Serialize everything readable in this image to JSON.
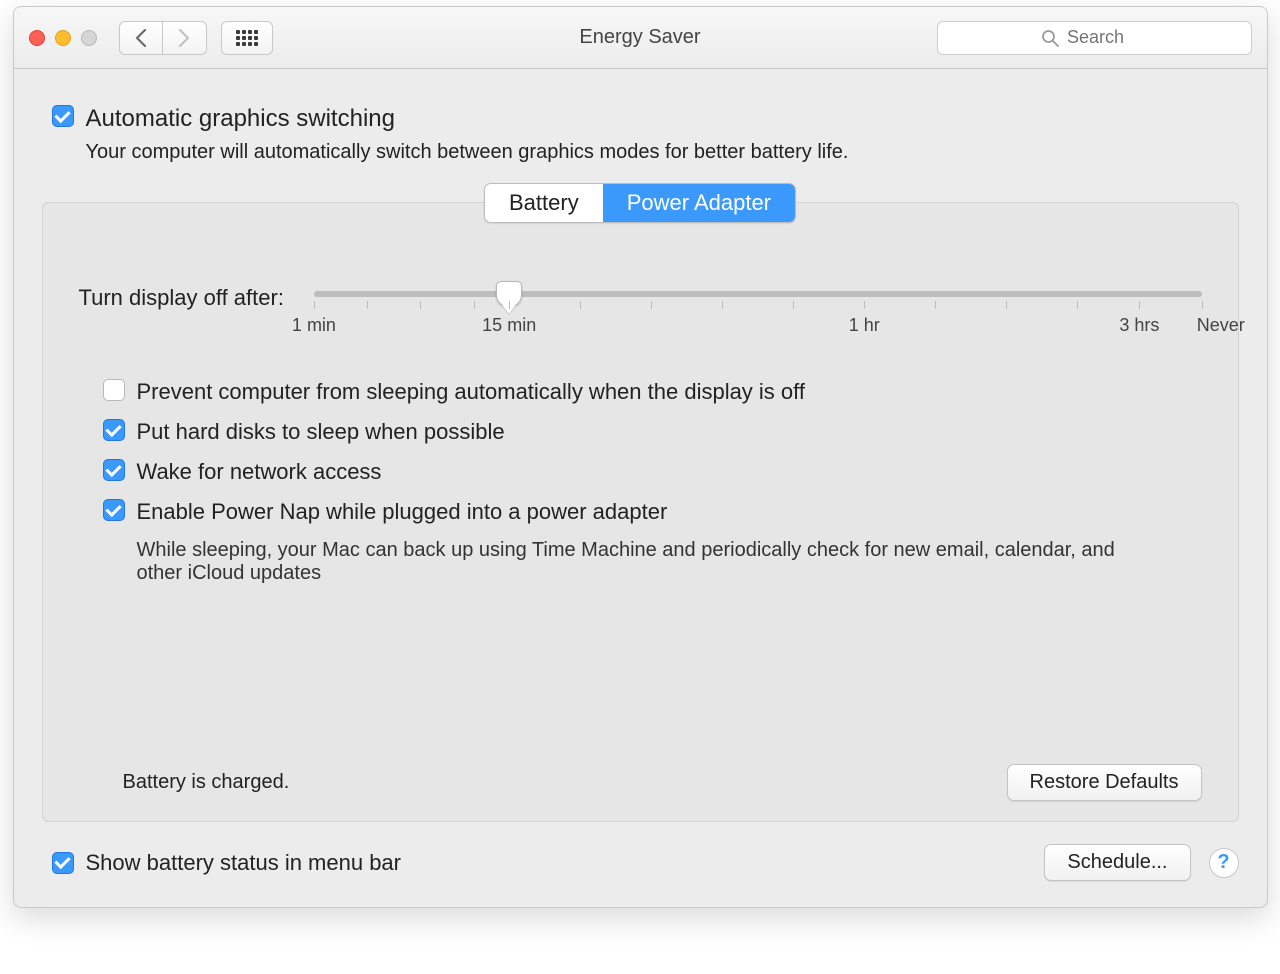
{
  "window": {
    "title": "Energy Saver"
  },
  "search": {
    "placeholder": "Search"
  },
  "auto_graphics": {
    "label": "Automatic graphics switching",
    "checked": true,
    "description": "Your computer will automatically switch between graphics modes for better battery life."
  },
  "tabs": {
    "battery": "Battery",
    "power_adapter": "Power Adapter",
    "active": "power_adapter"
  },
  "slider": {
    "label": "Turn display off after:",
    "ticks": [
      "1 min",
      "15 min",
      "1 hr",
      "3 hrs",
      "Never"
    ]
  },
  "options": {
    "prevent_sleep": {
      "label": "Prevent computer from sleeping automatically when the display is off",
      "checked": false
    },
    "hard_disks": {
      "label": "Put hard disks to sleep when possible",
      "checked": true
    },
    "wake_network": {
      "label": "Wake for network access",
      "checked": true
    },
    "power_nap": {
      "label": "Enable Power Nap while plugged into a power adapter",
      "checked": true,
      "description": "While sleeping, your Mac can back up using Time Machine and periodically check for new email, calendar, and other iCloud updates"
    }
  },
  "status": "Battery is charged.",
  "buttons": {
    "restore": "Restore Defaults",
    "schedule": "Schedule..."
  },
  "footer": {
    "show_battery": {
      "label": "Show battery status in menu bar",
      "checked": true
    }
  },
  "help": "?"
}
